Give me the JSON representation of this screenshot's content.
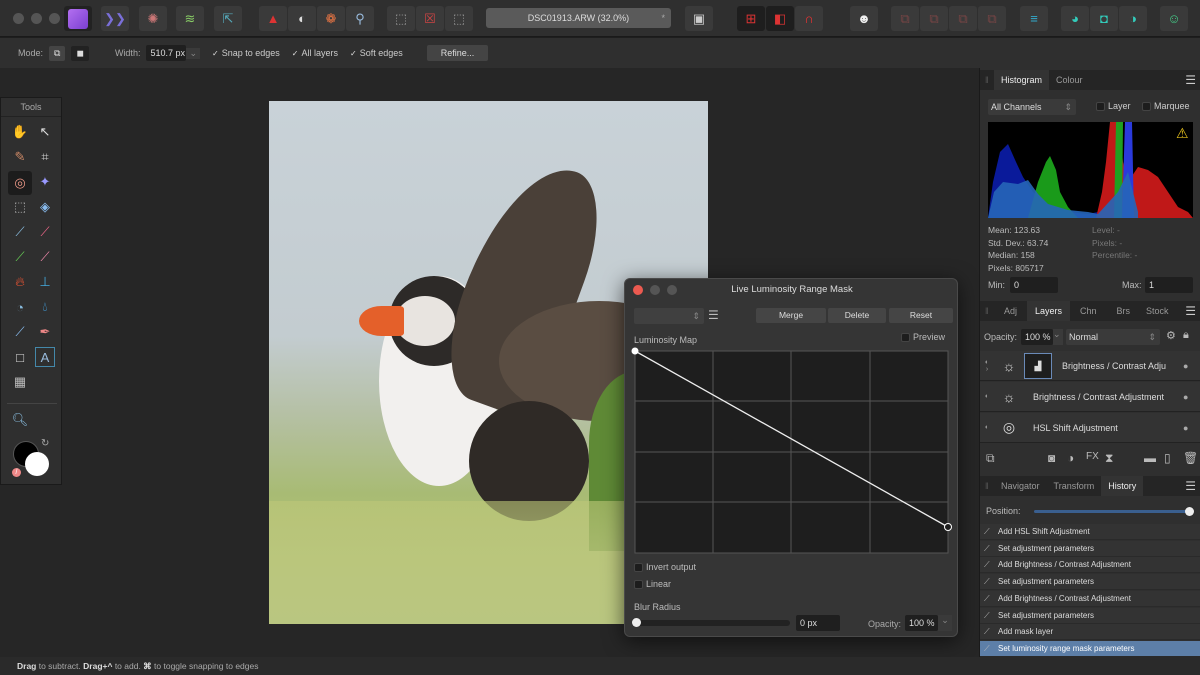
{
  "toolbar": {
    "document_title": "DSC01913.ARW (32.0%)",
    "modified_marker": "*"
  },
  "context": {
    "mode_label": "Mode:",
    "width_label": "Width:",
    "width_value": "510.7 px",
    "snap_label": "Snap to edges",
    "all_layers_label": "All layers",
    "soft_edges_label": "Soft edges",
    "refine_label": "Refine..."
  },
  "tools": {
    "title": "Tools"
  },
  "histogram": {
    "tabs": [
      "Histogram",
      "Colour"
    ],
    "channel": "All Channels",
    "layer_label": "Layer",
    "marquee_label": "Marquee",
    "mean": "Mean: 123.63",
    "std": "Std. Dev.: 63.74",
    "median": "Median: 158",
    "pixels": "Pixels: 805717",
    "level": "Level: -",
    "pixels_r": "Pixels: -",
    "percentile": "Percentile: -",
    "min_label": "Min:",
    "min_value": "0",
    "max_label": "Max:",
    "max_value": "1"
  },
  "layers": {
    "tabs": [
      "Adj",
      "Layers",
      "Chn",
      "Brs",
      "Stock"
    ],
    "opacity_label": "Opacity:",
    "opacity_value": "100 %",
    "blend_mode": "Normal",
    "items": [
      "Brightness / Contrast Adju",
      "Brightness / Contrast Adjustment",
      "HSL Shift Adjustment"
    ]
  },
  "history": {
    "tabs": [
      "Navigator",
      "Transform",
      "History"
    ],
    "position_label": "Position:",
    "position": 1.0,
    "items": [
      "Add HSL Shift Adjustment",
      "Set adjustment parameters",
      "Add Brightness / Contrast Adjustment",
      "Set adjustment parameters",
      "Add Brightness / Contrast Adjustment",
      "Set adjustment parameters",
      "Add mask layer",
      "Set luminosity range mask parameters"
    ]
  },
  "dialog": {
    "title": "Live Luminosity Range Mask",
    "merge": "Merge",
    "delete": "Delete",
    "reset": "Reset",
    "preview": "Preview",
    "map_label": "Luminosity Map",
    "invert": "Invert output",
    "linear": "Linear",
    "blur_label": "Blur Radius",
    "blur_value": "0 px",
    "blur_fraction": 0,
    "opacity_label": "Opacity:",
    "opacity_value": "100 %"
  },
  "status": {
    "b1": "Drag",
    "t1": " to subtract. ",
    "b2": "Drag+^",
    "t2": " to add. ",
    "b3": "⌘",
    "t3": " to toggle snapping to edges"
  }
}
